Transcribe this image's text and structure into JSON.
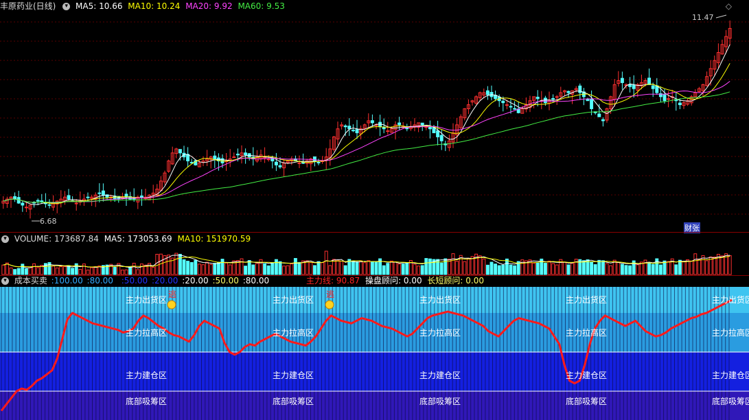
{
  "header": {
    "title": "丰原药业(日线)",
    "ma5_label": "MA5:",
    "ma5_value": "10.66",
    "ma5_color": "#ffffff",
    "ma10_label": "MA10:",
    "ma10_value": "10.24",
    "ma10_color": "#ffff00",
    "ma20_label": "MA20:",
    "ma20_value": "9.92",
    "ma20_color": "#ff44ff",
    "ma60_label": "MA60:",
    "ma60_value": "9.53",
    "ma60_color": "#44ee44"
  },
  "price_panel": {
    "high_label": "11.47",
    "low_label": "6.68",
    "signal_label": "财张"
  },
  "volume_panel": {
    "label": "VOLUME:",
    "value": "173687.84",
    "ma5_label": "MA5:",
    "ma5_value": "173053.69",
    "ma10_label": "MA10:",
    "ma10_value": "151970.59"
  },
  "cost_panel": {
    "title": "成本买卖",
    "levels": [
      {
        "text": ":100.00",
        "color": "#33aaff"
      },
      {
        "text": ":80.00",
        "color": "#33aaff"
      },
      {
        "text": ":50.00",
        "color": "#2233ff"
      },
      {
        "text": ":20.00",
        "color": "#2233ff"
      },
      {
        "text": ":20.00",
        "color": "#ffffff"
      },
      {
        "text": ":50.00",
        "color": "#ffff66"
      },
      {
        "text": ":80.00",
        "color": "#ffffff"
      }
    ],
    "mainline_label": "主力线:",
    "mainline_value": "90.87",
    "operate_label": "操盘顾问:",
    "operate_value": "0.00",
    "longshort_label": "长短顾问:",
    "longshort_value": "0.00",
    "zones": [
      "主力出货区",
      "主力拉高区",
      "主力建仓区",
      "底部吸筹区"
    ],
    "escape_label": "逃"
  },
  "chart_data": [
    {
      "type": "candlestick",
      "title": "丰原药业(日线)",
      "ylim": [
        6.3,
        11.7
      ],
      "overlay_lines": [
        "MA5",
        "MA10",
        "MA20",
        "MA60"
      ],
      "annotations": [
        {
          "text": "11.47"
        },
        {
          "text": "6.68"
        }
      ],
      "close": [
        7.0,
        7.05,
        7.1,
        7.05,
        6.95,
        6.9,
        6.85,
        6.9,
        6.95,
        7.0,
        7.0,
        6.95,
        6.9,
        6.95,
        7.0,
        7.05,
        7.1,
        7.05,
        7.0,
        6.95,
        7.0,
        7.05,
        7.1,
        7.1,
        7.15,
        7.2,
        7.15,
        7.1,
        7.1,
        7.05,
        7.05,
        7.1,
        7.1,
        7.05,
        7.05,
        7.1,
        7.1,
        7.1,
        7.15,
        7.2,
        7.3,
        7.5,
        7.7,
        8.0,
        8.2,
        8.3,
        8.2,
        8.1,
        8.0,
        7.95,
        7.9,
        7.95,
        8.0,
        8.05,
        8.1,
        8.05,
        8.0,
        7.95,
        8.0,
        8.05,
        8.1,
        8.15,
        8.2,
        8.15,
        8.1,
        8.05,
        8.1,
        8.15,
        8.1,
        8.05,
        8.0,
        7.9,
        7.85,
        7.95,
        8.0,
        8.05,
        8.0,
        7.95,
        7.95,
        8.0,
        8.05,
        8.0,
        7.95,
        8.0,
        8.1,
        8.3,
        8.6,
        8.8,
        8.9,
        8.85,
        8.8,
        8.75,
        8.7,
        8.8,
        8.9,
        9.0,
        8.95,
        8.9,
        8.85,
        8.8,
        8.75,
        8.8,
        8.9,
        8.9,
        8.85,
        8.8,
        8.85,
        8.9,
        8.95,
        8.9,
        8.85,
        8.8,
        8.7,
        8.6,
        8.5,
        8.4,
        8.5,
        8.7,
        8.9,
        9.1,
        9.3,
        9.4,
        9.5,
        9.6,
        9.7,
        9.7,
        9.65,
        9.6,
        9.55,
        9.5,
        9.45,
        9.4,
        9.35,
        9.3,
        9.2,
        9.3,
        9.4,
        9.5,
        9.6,
        9.55,
        9.5,
        9.45,
        9.5,
        9.55,
        9.6,
        9.7,
        9.75,
        9.7,
        9.75,
        9.8,
        9.7,
        9.6,
        9.5,
        9.3,
        9.2,
        9.1,
        9.0,
        9.3,
        9.6,
        9.9,
        10.0,
        9.95,
        9.9,
        9.85,
        9.8,
        9.9,
        9.95,
        10.0,
        9.9,
        9.8,
        9.7,
        9.6,
        9.5,
        9.55,
        9.6,
        9.5,
        9.4,
        9.45,
        9.5,
        9.6,
        9.7,
        9.8,
        9.9,
        10.1,
        10.3,
        10.5,
        10.7,
        10.9,
        11.1,
        11.3
      ]
    },
    {
      "type": "bar",
      "title": "VOLUME",
      "series": [
        {
          "name": "VOLUME"
        },
        {
          "name": "MA5"
        },
        {
          "name": "MA10"
        }
      ]
    },
    {
      "type": "line",
      "title": "成本买卖",
      "ylim": [
        0,
        100
      ],
      "series": [
        {
          "name": "主力线",
          "values": [
            5,
            10,
            15,
            20,
            22,
            21,
            24,
            28,
            30,
            33,
            36,
            45,
            60,
            75,
            80,
            78,
            76,
            74,
            72,
            71,
            70,
            69,
            68,
            67,
            65,
            66,
            68,
            74,
            78,
            76,
            73,
            70,
            68,
            65,
            63,
            62,
            60,
            58,
            63,
            70,
            74,
            72,
            70,
            68,
            57,
            50,
            48,
            50,
            54,
            56,
            55,
            58,
            60,
            62,
            64,
            62,
            60,
            58,
            57,
            56,
            55,
            58,
            62,
            68,
            74,
            78,
            76,
            74,
            73,
            72,
            74,
            76,
            75,
            74,
            72,
            70,
            69,
            68,
            66,
            64,
            62,
            64,
            68,
            72,
            76,
            78,
            79,
            80,
            81,
            80,
            79,
            78,
            76,
            74,
            72,
            70,
            66,
            64,
            62,
            66,
            70,
            74,
            76,
            75,
            74,
            73,
            72,
            70,
            68,
            62,
            56,
            40,
            28,
            26,
            28,
            40,
            56,
            68,
            74,
            78,
            76,
            74,
            72,
            70,
            72,
            74,
            70,
            66,
            64,
            62,
            63,
            65,
            68,
            70,
            72,
            74,
            76,
            77,
            79,
            80,
            82,
            84,
            86,
            88,
            90
          ]
        }
      ]
    }
  ]
}
